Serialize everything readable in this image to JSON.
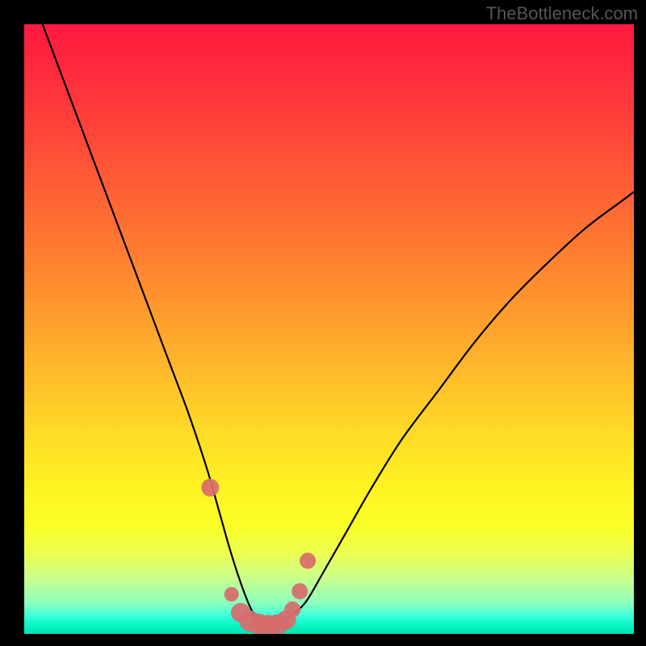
{
  "attribution": "TheBottleneck.com",
  "colors": {
    "frame": "#000000",
    "curve": "#000000",
    "marker_fill": "#d86b6b",
    "marker_stroke": "#b84f4f",
    "gradient_top": "#ff193f",
    "gradient_bottom": "#00e4ae"
  },
  "chart_data": {
    "type": "line",
    "title": "",
    "xlabel": "",
    "ylabel": "",
    "xlim": [
      0,
      100
    ],
    "ylim": [
      0,
      100
    ],
    "grid": false,
    "legend": false,
    "series": [
      {
        "name": "bottleneck-curve",
        "x": [
          0,
          3,
          6,
          9,
          12,
          15,
          18,
          21,
          24,
          27,
          30,
          32,
          34,
          36,
          37.5,
          39,
          41,
          43,
          46,
          49,
          53,
          57,
          62,
          68,
          74,
          80,
          86,
          92,
          98,
          100
        ],
        "y": [
          108,
          100,
          92,
          84,
          76,
          68,
          60,
          52,
          44,
          36,
          27,
          20,
          13,
          7,
          3.5,
          1.5,
          1.3,
          2.5,
          5,
          10,
          17,
          24,
          32,
          40,
          48,
          55,
          61,
          66.5,
          71,
          72.5
        ]
      }
    ],
    "markers": {
      "name": "highlight-points",
      "x": [
        30.5,
        34.0,
        35.5,
        37.0,
        38.5,
        40.0,
        41.5,
        43.0,
        44.0,
        45.2,
        46.5
      ],
      "y": [
        24.0,
        6.5,
        3.5,
        2.1,
        1.6,
        1.4,
        1.5,
        2.3,
        4.0,
        7.0,
        12.0
      ],
      "r": [
        11,
        9,
        12,
        13,
        13,
        13,
        13,
        12,
        10,
        10,
        10
      ]
    }
  }
}
